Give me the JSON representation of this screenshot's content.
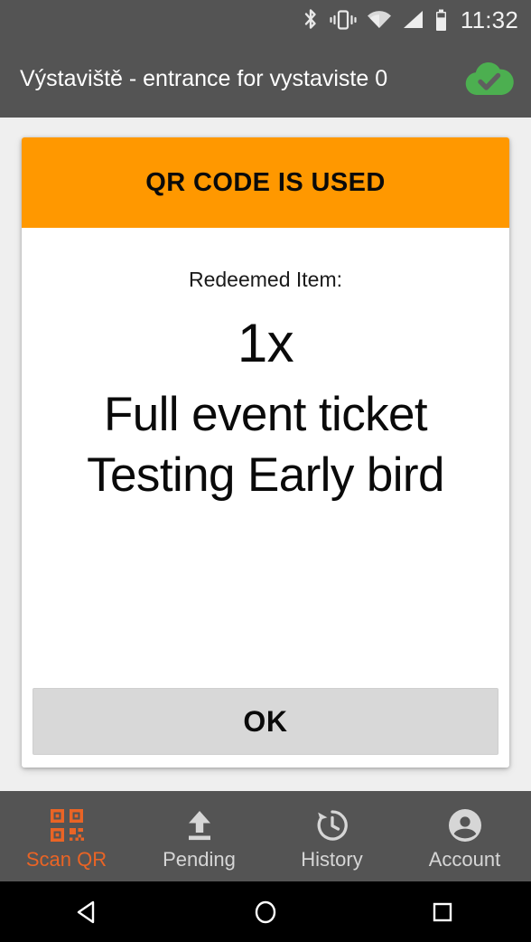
{
  "status_bar": {
    "time": "11:32",
    "icons": [
      "bluetooth-icon",
      "vibrate-icon",
      "wifi-icon",
      "signal-icon",
      "battery-icon"
    ],
    "background": "#545454"
  },
  "header": {
    "title": "Výstaviště - entrance for vystaviste 0",
    "sync_icon": "cloud-check-icon",
    "sync_color": "#4caf50",
    "background": "#545454"
  },
  "card": {
    "banner": {
      "text": "QR CODE IS USED",
      "background": "#ff9800",
      "text_color": "#0a0a0a"
    },
    "redeemed_label": "Redeemed Item:",
    "quantity": "1x",
    "item_name": "Full event ticket Testing Early bird",
    "ok_label": "OK"
  },
  "tab_bar": {
    "active_color": "#ea6425",
    "inactive_color": "#d6d6d6",
    "items": [
      {
        "label": "Scan QR",
        "icon": "qr-code-icon",
        "active": true
      },
      {
        "label": "Pending",
        "icon": "upload-icon",
        "active": false
      },
      {
        "label": "History",
        "icon": "history-clock-icon",
        "active": false
      },
      {
        "label": "Account",
        "icon": "account-person-icon",
        "active": false
      }
    ]
  },
  "nav_bar": {
    "buttons": [
      {
        "name": "back-icon"
      },
      {
        "name": "home-icon"
      },
      {
        "name": "recents-icon"
      }
    ]
  }
}
